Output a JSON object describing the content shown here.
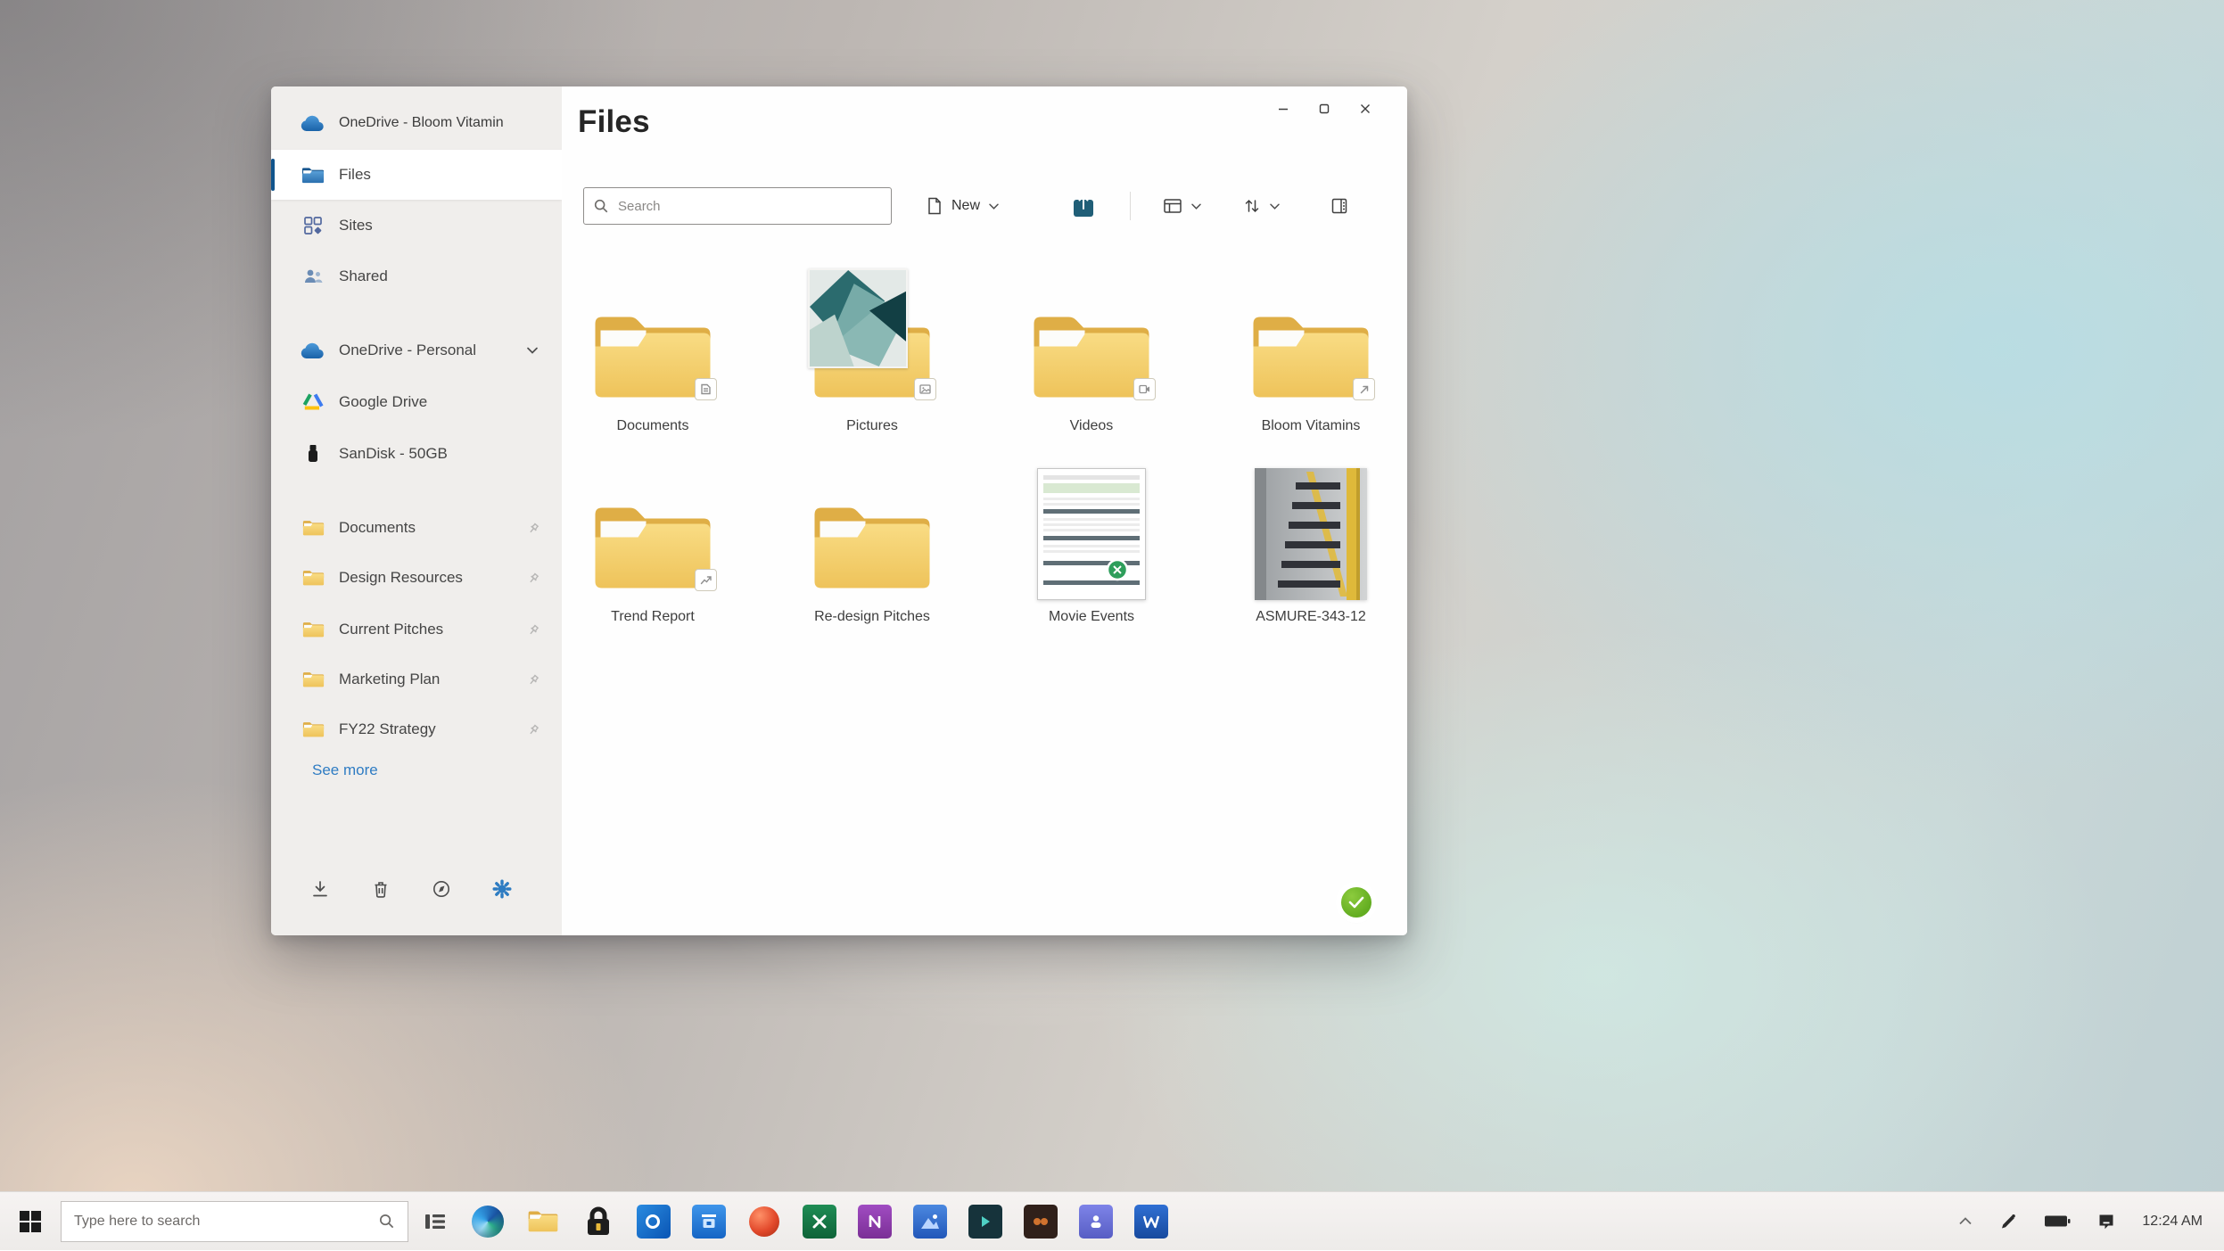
{
  "colors": {
    "accent_blue": "#10548c",
    "folder_yellow": "#f0c75f",
    "sync_green": "#63ad21",
    "share_teal": "#205e77",
    "link_blue": "#2f7cc3"
  },
  "window": {
    "control_icons": [
      "minimize-icon",
      "maximize-icon",
      "close-icon"
    ],
    "sidebar": {
      "account_label": "OneDrive - Bloom Vitamin",
      "nav": [
        {
          "label": "Files",
          "icon": "files-folder-icon",
          "selected": true
        },
        {
          "label": "Sites",
          "icon": "sites-grid-icon",
          "selected": false
        },
        {
          "label": "Shared",
          "icon": "shared-people-icon",
          "selected": false
        }
      ],
      "drives": [
        {
          "label": "OneDrive - Personal",
          "icon": "onedrive-cloud-icon",
          "has_chevron": true
        },
        {
          "label": "Google Drive",
          "icon": "google-drive-icon",
          "has_chevron": false
        },
        {
          "label": "SanDisk - 50GB",
          "icon": "usb-drive-icon",
          "has_chevron": false
        }
      ],
      "pinned": [
        {
          "label": "Documents"
        },
        {
          "label": "Design Resources"
        },
        {
          "label": "Current Pitches"
        },
        {
          "label": "Marketing Plan"
        },
        {
          "label": "FY22 Strategy"
        }
      ],
      "see_more_label": "See more",
      "footer_icons": [
        "download-icon",
        "recycle-bin-icon",
        "compass-icon",
        "sync-settings-icon"
      ]
    },
    "header": {
      "title": "Files"
    },
    "toolbar": {
      "search_placeholder": "Search",
      "new_label": "New",
      "icons": [
        "new-document-icon",
        "chevron-down-icon",
        "share-icon",
        "view-options-icon",
        "sort-icon",
        "details-view-icon"
      ]
    },
    "grid": {
      "items": [
        {
          "label": "Documents",
          "kind": "folder",
          "badge": "document"
        },
        {
          "label": "Pictures",
          "kind": "folder-with-thumbnail",
          "badge": "image"
        },
        {
          "label": "Videos",
          "kind": "folder",
          "badge": "video"
        },
        {
          "label": "Bloom Vitamins",
          "kind": "folder",
          "badge": "shortcut"
        },
        {
          "label": "Trend Report",
          "kind": "folder",
          "badge": "trend-chart"
        },
        {
          "label": "Re-design Pitches",
          "kind": "folder",
          "badge": "none"
        },
        {
          "label": "Movie Events",
          "kind": "spreadsheet-file",
          "badge": "excel"
        },
        {
          "label": "ASMURE-343-12",
          "kind": "image-file",
          "badge": "none"
        }
      ]
    },
    "status": {
      "sync_icon": "synced-check-icon"
    }
  },
  "taskbar": {
    "start_icon": "windows-start-icon",
    "search_placeholder": "Type here to search",
    "task_view_icon": "task-view-icon",
    "apps": [
      "edge",
      "file-explorer",
      "password-lock",
      "outlook",
      "microsoft-store",
      "red-sphere-app",
      "excel",
      "onenote",
      "photos",
      "dev-tool",
      "coffee-app",
      "teams",
      "word"
    ],
    "tray_icons": [
      "hidden-icons-chevron",
      "pen-icon",
      "battery-icon",
      "action-center-icon"
    ],
    "clock": "12:24 AM"
  }
}
